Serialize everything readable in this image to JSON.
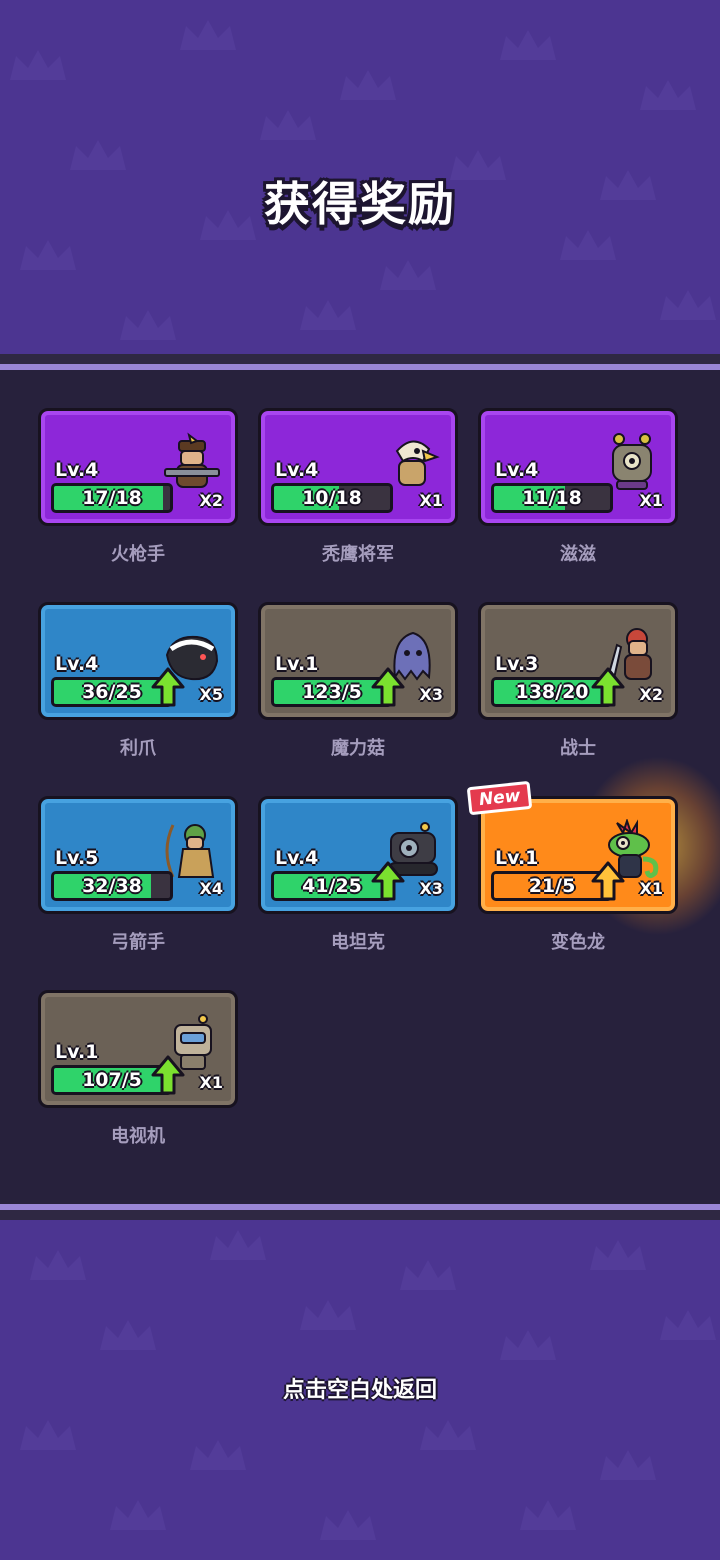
{
  "title": "获得奖励",
  "footer_hint": "点击空白处返回",
  "colors": {
    "background": "#4c3591",
    "panel": "#27213c",
    "rarity_purple": "#8d27d9",
    "rarity_blue": "#2f86c8",
    "rarity_gray": "#6b6156",
    "rarity_orange": "#ff8a1a",
    "progress_green": "#2fd36a"
  },
  "rewards": [
    {
      "name": "火枪手",
      "level": "Lv.4",
      "progress": "17/18",
      "progress_fraction": 0.94,
      "count": "X2",
      "rarity": "purple",
      "upgrade": false,
      "new": false,
      "icon": "musketeer-icon"
    },
    {
      "name": "秃鹰将军",
      "level": "Lv.4",
      "progress": "10/18",
      "progress_fraction": 0.56,
      "count": "X1",
      "rarity": "purple",
      "upgrade": false,
      "new": false,
      "icon": "vulture-general-icon"
    },
    {
      "name": "滋滋",
      "level": "Lv.4",
      "progress": "11/18",
      "progress_fraction": 0.61,
      "count": "X1",
      "rarity": "purple",
      "upgrade": false,
      "new": false,
      "icon": "zizi-robot-icon"
    },
    {
      "name": "利爪",
      "level": "Lv.4",
      "progress": "36/25",
      "progress_fraction": 1.0,
      "count": "X5",
      "rarity": "blue",
      "upgrade": true,
      "new": false,
      "icon": "claw-beast-icon"
    },
    {
      "name": "魔力菇",
      "level": "Lv.1",
      "progress": "123/5",
      "progress_fraction": 1.0,
      "count": "X3",
      "rarity": "gray",
      "upgrade": true,
      "new": false,
      "icon": "magic-mushroom-icon"
    },
    {
      "name": "战士",
      "level": "Lv.3",
      "progress": "138/20",
      "progress_fraction": 1.0,
      "count": "X2",
      "rarity": "gray",
      "upgrade": true,
      "new": false,
      "icon": "warrior-icon"
    },
    {
      "name": "弓箭手",
      "level": "Lv.5",
      "progress": "32/38",
      "progress_fraction": 0.84,
      "count": "X4",
      "rarity": "blue",
      "upgrade": false,
      "new": false,
      "icon": "archer-icon"
    },
    {
      "name": "电坦克",
      "level": "Lv.4",
      "progress": "41/25",
      "progress_fraction": 1.0,
      "count": "X3",
      "rarity": "blue",
      "upgrade": true,
      "new": false,
      "icon": "electric-tank-icon"
    },
    {
      "name": "变色龙",
      "level": "Lv.1",
      "progress": "21/5",
      "progress_fraction": 1.0,
      "count": "X1",
      "rarity": "orange",
      "upgrade": true,
      "new": true,
      "new_label": "New",
      "icon": "chameleon-icon"
    },
    {
      "name": "电视机",
      "level": "Lv.1",
      "progress": "107/5",
      "progress_fraction": 1.0,
      "count": "X1",
      "rarity": "gray",
      "upgrade": true,
      "new": false,
      "icon": "tv-robot-icon"
    }
  ]
}
